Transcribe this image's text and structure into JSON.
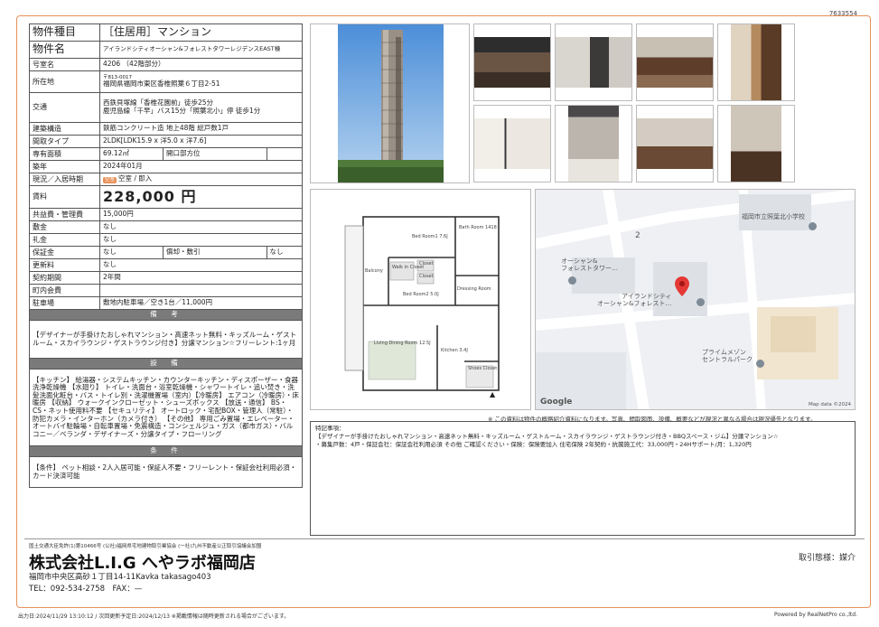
{
  "doc_id": "7633554",
  "property": {
    "type_label": "物件種目",
    "type_value": "［住居用］マンション",
    "name_label": "物件名",
    "name_value": "アイランドシティオーシャン&フォレストタワーレジデンスEAST棟",
    "room_label": "号室名",
    "room_value": "4206 （42階部分）",
    "location_label": "所在地",
    "postal": "〒813-0017",
    "address": "福岡県福岡市東区香椎照葉６丁目2-51",
    "traffic_label": "交通",
    "traffic_1": "西鉄貝塚線「香椎花園前」徒歩25分",
    "traffic_2": "鹿児島線「千早」バス15分「照葉北小」停 徒歩1分",
    "structure_label": "建築構造",
    "structure_value": "鉄筋コンクリート造 地上48階 総戸数1戸",
    "layout_label": "間取タイプ",
    "layout_value": "2LDK[LDK15.9 x 洋5.0 x 洋7.6]",
    "area_label": "専有面積",
    "area_value": "69.12㎡",
    "opening_label": "開口部方位",
    "opening_value": "",
    "built_label": "築年",
    "built_value": "2024年01月",
    "status_label": "現況／入居時期",
    "status_badge": "空室",
    "status_value": "空室 / 即入",
    "rent_label": "賃料",
    "rent_value": "228,000 円",
    "fee_label": "共益費・管理費",
    "fee_value": "15,000円",
    "deposit_label": "敷金",
    "deposit_value": "なし",
    "keymoney_label": "礼金",
    "keymoney_value": "なし",
    "guarantee_label": "保証金",
    "guarantee_value": "なし",
    "amortization_label": "償却・敷引",
    "amortization_value": "なし",
    "renewal_label": "更新料",
    "renewal_value": "なし",
    "contract_label": "契約期間",
    "contract_value": "2年間",
    "association_label": "町内会費",
    "association_value": "",
    "parking_label": "駐車場",
    "parking_value": "敷地内駐車場／空き1台／11,000円"
  },
  "remarks": {
    "head": "備　考",
    "body": "【デザイナーが手掛けたおしゃれマンション・高速ネット無料・キッズルーム・ゲストルーム・スカイラウンジ・ゲストラウンジ付き】分譲マンション☆フリーレント:1ヶ月"
  },
  "facilities": {
    "head": "設　備",
    "body": "【キッチン】 給湯器・システムキッチン・カウンターキッチン・ディスポーザー・食器洗浄乾燥機 【水廻り】 トイレ・洗面台・浴室乾燥機・シャワートイレ・追い焚き・洗髪洗面化粧台・バス・トイレ別・洗濯機置場（室内）【冷暖房】 エアコン（冷暖房）・床暖房 【収納】 ウォークインクローゼット・シューズボックス 【放送・通信】 BS・CS・ネット使用料不要 【セキュリティ】 オートロック・宅配BOX・管理人（常駐）・防犯カメラ・インターホン（カメラ付き） 【その他】 専用ごみ置場・エレベーター・オートバイ駐輪場・自転車置場・免震構造・コンシェルジュ・ガス（都市ガス）・バルコニー／ベランダ・デザイナーズ・分譲タイプ・フローリング"
  },
  "conditions": {
    "head": "条　件",
    "body": "【条件】 ペット相談・2人入居可能・保証人不要・フリーレント・保証会社利用必須・カード決済可能"
  },
  "floorplan": {
    "rooms": {
      "bed1": "Bed Room1\n7.6J",
      "bath": "Bath\nRoom\n1418",
      "balcony": "Balcony",
      "wic": "Walk in\nCloset",
      "closet1": "Closet",
      "closet2": "Closet",
      "dressing": "Dressing\nRoom",
      "bed2": "Bed Room2\n5.0J",
      "living": "Living·Dining\nRoom\n12.5J",
      "kitchen": "Kitchen\n3.4J",
      "shoes": "Shoes\nCloset"
    }
  },
  "map": {
    "school": "福岡市立照葉北小学校",
    "number": "2",
    "tower_1": "オーシャン&\nフォレストタワー…",
    "tower_2": "アイランドシティ\nオーシャン&フォレスト…",
    "park": "プライムメゾン\nセントラルパーク",
    "google": "Google",
    "credit": "Map data ©2024"
  },
  "disclaimer": "※ この資料は物件の概略紹介資料になります。写真、間取図面、設備、概要などが現況と異なる場合は現況優先となります。",
  "special": {
    "title": "特記事項：",
    "line1": "【デザイナーが手掛けたおしゃれマンション・高速ネット無料・キッズルーム・ゲストルーム・スカイラウンジ・ゲストラウンジ付き・BBQスペース・ジム】分譲マンション☆",
    "line2": "・募集戸数：4戸・保証会社：保証会社利用必須 その他 ご確認ください・保険：保険要加入 住宅保険 2年契約・抗菌施工代：33,000円・24Hサポート/月：1,320円"
  },
  "footer": {
    "license": "国土交通大臣免許(1)第10466号 (公社)福岡県宅地建物取引業協会 (一社)九州不動産公正取引協議会加盟",
    "company": "株式会社L.I.G へやラボ福岡店",
    "address": "福岡市中央区高砂１丁目14-11Kavka takasago403",
    "tel": "TEL：092-534-2758　FAX：—",
    "transaction": "取引態様：媒介",
    "printed": "出力日:2024/11/29 13:10:12 / 次回更新予定日:2024/12/13 ※掲載情報は随時更新される場合がございます。",
    "powered": "Powered by RealNetPro co.,ltd."
  }
}
